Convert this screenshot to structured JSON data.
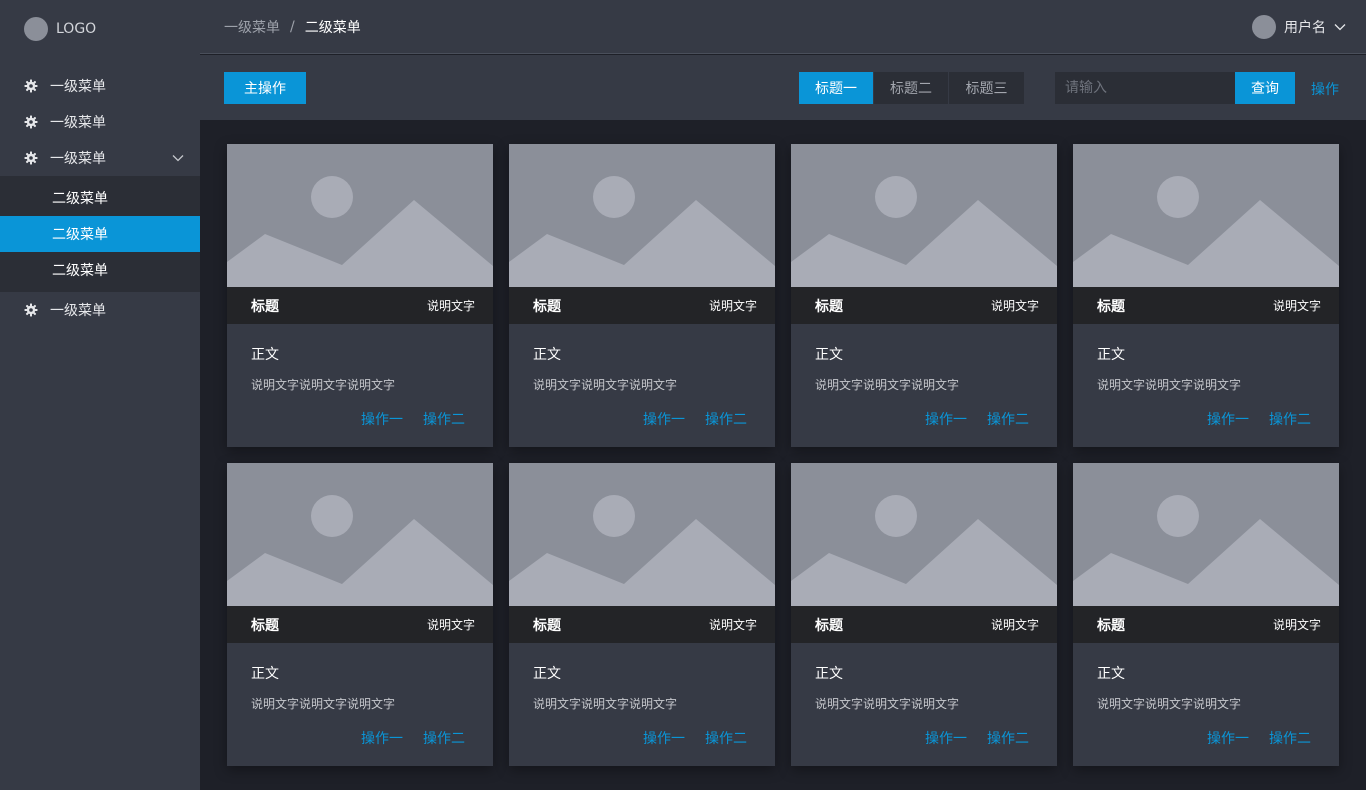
{
  "logo": {
    "text": "LOGO"
  },
  "sidebar": {
    "items": [
      {
        "label": "一级菜单",
        "icon": "gear-icon"
      },
      {
        "label": "一级菜单",
        "icon": "gear-icon"
      },
      {
        "label": "一级菜单",
        "icon": "gear-icon",
        "expanded": true
      },
      {
        "label": "一级菜单",
        "icon": "gear-icon"
      }
    ],
    "subitems": [
      {
        "label": "二级菜单"
      },
      {
        "label": "二级菜单",
        "active": true
      },
      {
        "label": "二级菜单"
      }
    ]
  },
  "header": {
    "breadcrumb": [
      "一级菜单",
      "二级菜单"
    ],
    "separator": "/",
    "username": "用户名"
  },
  "toolbar": {
    "primary_label": "主操作",
    "tabs": [
      {
        "label": "标题一",
        "active": true
      },
      {
        "label": "标题二"
      },
      {
        "label": "标题三"
      }
    ],
    "search_placeholder": "请输入",
    "search_label": "查询",
    "action_label": "操作"
  },
  "cards": [
    {
      "title": "标题",
      "note": "说明文字",
      "heading": "正文",
      "desc": "说明文字说明文字说明文字",
      "action1": "操作一",
      "action2": "操作二"
    },
    {
      "title": "标题",
      "note": "说明文字",
      "heading": "正文",
      "desc": "说明文字说明文字说明文字",
      "action1": "操作一",
      "action2": "操作二"
    },
    {
      "title": "标题",
      "note": "说明文字",
      "heading": "正文",
      "desc": "说明文字说明文字说明文字",
      "action1": "操作一",
      "action2": "操作二"
    },
    {
      "title": "标题",
      "note": "说明文字",
      "heading": "正文",
      "desc": "说明文字说明文字说明文字",
      "action1": "操作一",
      "action2": "操作二"
    },
    {
      "title": "标题",
      "note": "说明文字",
      "heading": "正文",
      "desc": "说明文字说明文字说明文字",
      "action1": "操作一",
      "action2": "操作二"
    },
    {
      "title": "标题",
      "note": "说明文字",
      "heading": "正文",
      "desc": "说明文字说明文字说明文字",
      "action1": "操作一",
      "action2": "操作二"
    },
    {
      "title": "标题",
      "note": "说明文字",
      "heading": "正文",
      "desc": "说明文字说明文字说明文字",
      "action1": "操作一",
      "action2": "操作二"
    },
    {
      "title": "标题",
      "note": "说明文字",
      "heading": "正文",
      "desc": "说明文字说明文字说明文字",
      "action1": "操作一",
      "action2": "操作二"
    }
  ],
  "colors": {
    "accent": "#0a95d7",
    "sidebar_bg": "#363a45",
    "content_bg": "#1e2028",
    "card_head_bg": "#232427",
    "image_bg": "#8b8f99",
    "image_fg": "#a9acb6"
  }
}
